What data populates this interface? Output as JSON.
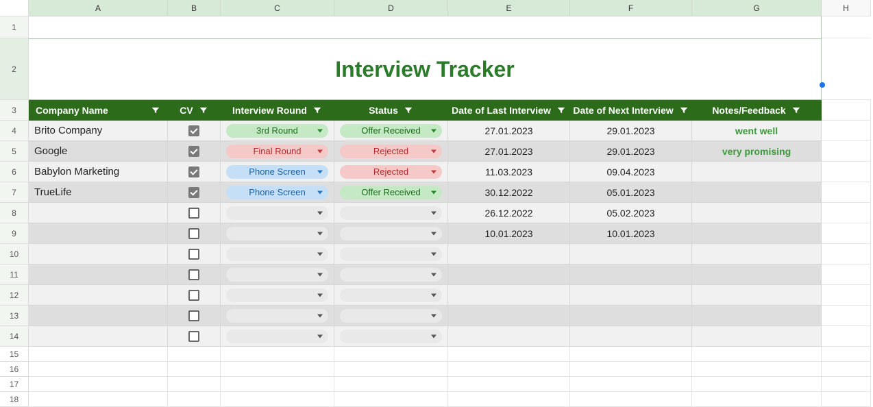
{
  "columns": [
    "A",
    "B",
    "C",
    "D",
    "E",
    "F",
    "G",
    "H"
  ],
  "title": "Interview Tracker",
  "headers": {
    "company": "Company Name",
    "cv": "CV",
    "round": "Interview Round",
    "status": "Status",
    "last": "Date of Last Interview",
    "next": "Date of Next Interview",
    "notes": "Notes/Feedback"
  },
  "rows": [
    {
      "n": "4",
      "shade": "light",
      "company": "Brito Company",
      "cv": true,
      "round": {
        "text": "3rd Round",
        "style": "green"
      },
      "status": {
        "text": "Offer Received",
        "style": "green"
      },
      "last": "27.01.2023",
      "next": "29.01.2023",
      "notes": "went well"
    },
    {
      "n": "5",
      "shade": "dark",
      "company": "Google",
      "cv": true,
      "round": {
        "text": "Final Round",
        "style": "red"
      },
      "status": {
        "text": "Rejected",
        "style": "red"
      },
      "last": "27.01.2023",
      "next": "29.01.2023",
      "notes": "very promising"
    },
    {
      "n": "6",
      "shade": "light",
      "company": "Babylon Marketing",
      "cv": true,
      "round": {
        "text": "Phone Screen",
        "style": "blue"
      },
      "status": {
        "text": "Rejected",
        "style": "red"
      },
      "last": "11.03.2023",
      "next": "09.04.2023",
      "notes": ""
    },
    {
      "n": "7",
      "shade": "dark",
      "company": "TrueLife",
      "cv": true,
      "round": {
        "text": "Phone Screen",
        "style": "blue"
      },
      "status": {
        "text": "Offer Received",
        "style": "green"
      },
      "last": "30.12.2022",
      "next": "05.01.2023",
      "notes": ""
    },
    {
      "n": "8",
      "shade": "light",
      "company": "",
      "cv": false,
      "round": {
        "text": "",
        "style": "empty"
      },
      "status": {
        "text": "",
        "style": "empty"
      },
      "last": "26.12.2022",
      "next": "05.02.2023",
      "notes": ""
    },
    {
      "n": "9",
      "shade": "dark",
      "company": "",
      "cv": false,
      "round": {
        "text": "",
        "style": "empty"
      },
      "status": {
        "text": "",
        "style": "empty"
      },
      "last": "10.01.2023",
      "next": "10.01.2023",
      "notes": ""
    },
    {
      "n": "10",
      "shade": "light",
      "company": "",
      "cv": false,
      "round": {
        "text": "",
        "style": "empty"
      },
      "status": {
        "text": "",
        "style": "empty"
      },
      "last": "",
      "next": "",
      "notes": ""
    },
    {
      "n": "11",
      "shade": "dark",
      "company": "",
      "cv": false,
      "round": {
        "text": "",
        "style": "empty"
      },
      "status": {
        "text": "",
        "style": "empty"
      },
      "last": "",
      "next": "",
      "notes": ""
    },
    {
      "n": "12",
      "shade": "light",
      "company": "",
      "cv": false,
      "round": {
        "text": "",
        "style": "empty"
      },
      "status": {
        "text": "",
        "style": "empty"
      },
      "last": "",
      "next": "",
      "notes": ""
    },
    {
      "n": "13",
      "shade": "dark",
      "company": "",
      "cv": false,
      "round": {
        "text": "",
        "style": "empty"
      },
      "status": {
        "text": "",
        "style": "empty"
      },
      "last": "",
      "next": "",
      "notes": ""
    },
    {
      "n": "14",
      "shade": "light",
      "company": "",
      "cv": false,
      "round": {
        "text": "",
        "style": "empty"
      },
      "status": {
        "text": "",
        "style": "empty"
      },
      "last": "",
      "next": "",
      "notes": ""
    }
  ],
  "empty_rows": [
    "15",
    "16",
    "17",
    "18"
  ]
}
